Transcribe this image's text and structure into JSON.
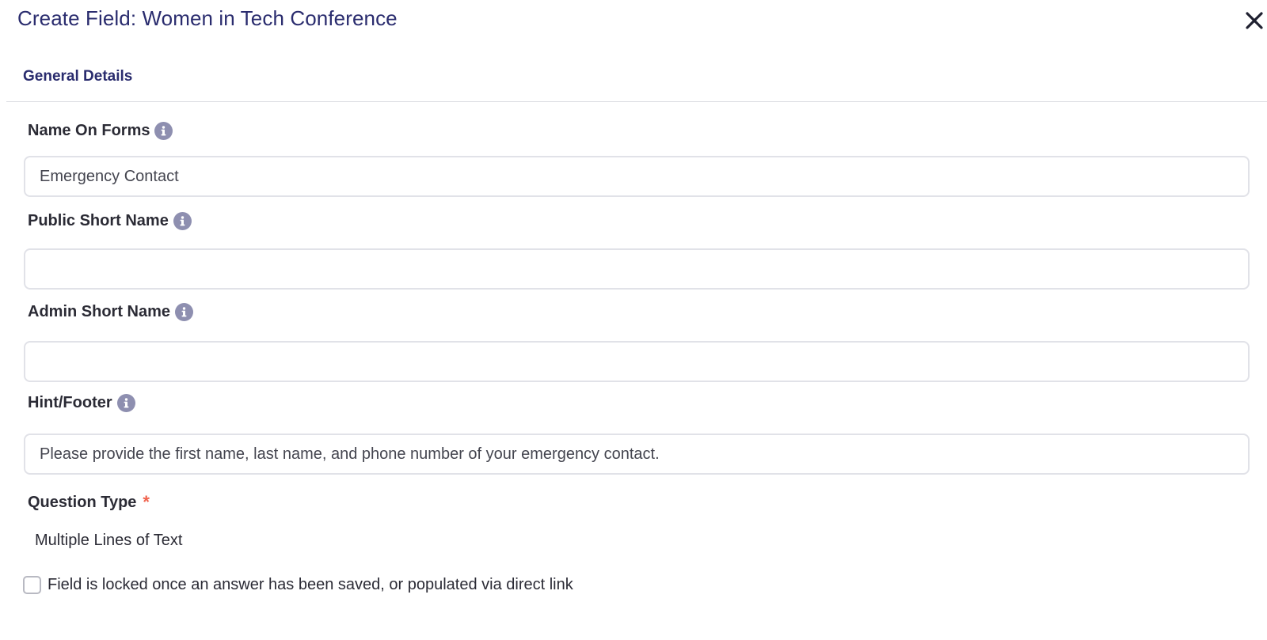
{
  "header": {
    "title": "Create Field: Women in Tech Conference"
  },
  "tabs": {
    "general": "General Details"
  },
  "fields": {
    "name_on_forms": {
      "label": "Name On Forms",
      "value": "Emergency Contact"
    },
    "public_short_name": {
      "label": "Public Short Name",
      "value": ""
    },
    "admin_short_name": {
      "label": "Admin Short Name",
      "value": ""
    },
    "hint_footer": {
      "label": "Hint/Footer",
      "value": "Please provide the first name, last name, and phone number of your emergency contact."
    }
  },
  "question_type": {
    "label": "Question Type",
    "required_mark": "*",
    "value": "Multiple Lines of Text"
  },
  "lock_option": {
    "label": "Field is locked once an answer has been saved, or populated via direct link",
    "checked": false
  },
  "icons": {
    "close": "close-icon",
    "info": "info-icon"
  },
  "colors": {
    "title": "#2a2c6e",
    "info_icon": "#8e8fb0",
    "required": "#f0624d",
    "input_border": "#e1e2e8"
  }
}
